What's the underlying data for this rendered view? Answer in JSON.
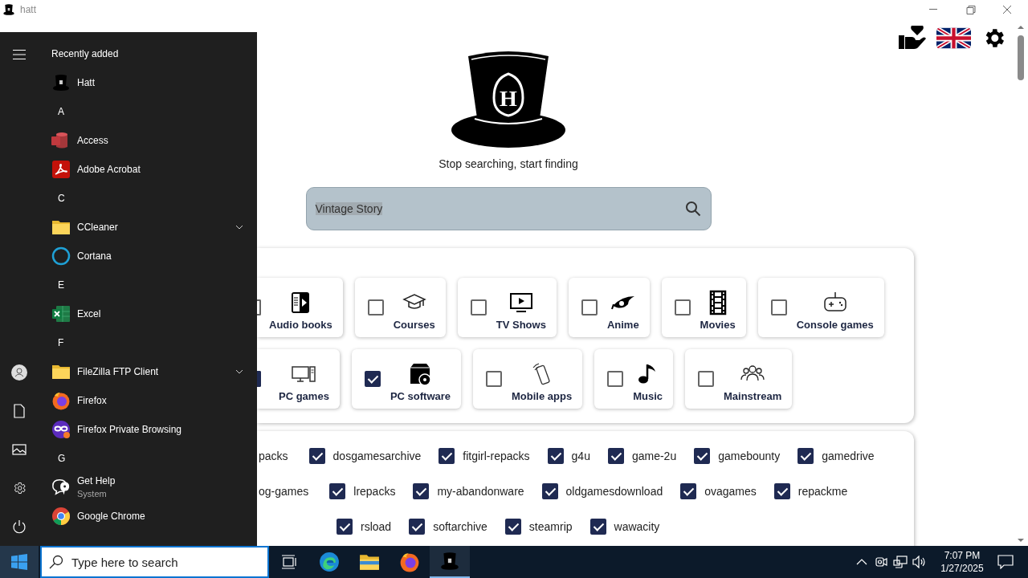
{
  "window": {
    "title": "hatt"
  },
  "logo": {
    "letter": "H"
  },
  "tagline": "Stop searching, start finding",
  "search": {
    "value": "Vintage Story",
    "text_selected": true
  },
  "categories": {
    "rows": [
      [
        {
          "kind": "partial",
          "label": "Audio books",
          "checked": false
        },
        {
          "kind": "full",
          "label": "Courses",
          "checked": false
        },
        {
          "kind": "full",
          "label": "TV Shows",
          "checked": false
        },
        {
          "kind": "full",
          "label": "Anime",
          "checked": false
        },
        {
          "kind": "full",
          "label": "Movies",
          "checked": false
        },
        {
          "kind": "full",
          "label": "Console games",
          "checked": false
        }
      ],
      [
        {
          "kind": "partial",
          "label": "PC games",
          "checked": true
        },
        {
          "kind": "full",
          "label": "PC software",
          "checked": true
        },
        {
          "kind": "full",
          "label": "Mobile apps",
          "checked": false
        },
        {
          "kind": "full",
          "label": "Music",
          "checked": false
        },
        {
          "kind": "full",
          "label": "Mainstream",
          "checked": false
        }
      ]
    ]
  },
  "sources": {
    "rows": [
      {
        "cut_label": "packs",
        "items": [
          {
            "label": "dosgamesarchive",
            "checked": true
          },
          {
            "label": "fitgirl-repacks",
            "checked": true
          },
          {
            "label": "g4u",
            "checked": true
          },
          {
            "label": "game-2u",
            "checked": true
          },
          {
            "label": "gamebounty",
            "checked": true
          },
          {
            "label": "gamedrive",
            "checked": true
          }
        ]
      },
      {
        "cut_label": "og-games",
        "items": [
          {
            "label": "lrepacks",
            "checked": true
          },
          {
            "label": "my-abandonware",
            "checked": true
          },
          {
            "label": "oldgamesdownload",
            "checked": true
          },
          {
            "label": "ovagames",
            "checked": true
          },
          {
            "label": "repackme",
            "checked": true
          }
        ]
      },
      {
        "items": [
          {
            "label": "rsload",
            "checked": true
          },
          {
            "label": "softarchive",
            "checked": true
          },
          {
            "label": "steamrip",
            "checked": true
          },
          {
            "label": "wawacity",
            "checked": true
          }
        ]
      }
    ]
  },
  "start_menu": {
    "header": "Recently added",
    "items": [
      {
        "kind": "app",
        "label": "Hatt"
      },
      {
        "kind": "letter",
        "label": "A"
      },
      {
        "kind": "app",
        "label": "Access"
      },
      {
        "kind": "app",
        "label": "Adobe Acrobat"
      },
      {
        "kind": "letter",
        "label": "C"
      },
      {
        "kind": "folder",
        "label": "CCleaner"
      },
      {
        "kind": "app",
        "label": "Cortana"
      },
      {
        "kind": "letter",
        "label": "E"
      },
      {
        "kind": "app",
        "label": "Excel"
      },
      {
        "kind": "letter",
        "label": "F"
      },
      {
        "kind": "folder",
        "label": "FileZilla FTP Client"
      },
      {
        "kind": "app",
        "label": "Firefox"
      },
      {
        "kind": "app",
        "label": "Firefox Private Browsing"
      },
      {
        "kind": "letter",
        "label": "G"
      },
      {
        "kind": "app",
        "label": "Get Help",
        "subtitle": "System"
      },
      {
        "kind": "app",
        "label": "Google Chrome"
      }
    ]
  },
  "taskbar": {
    "search_placeholder": "Type here to search",
    "apps": [
      {
        "active": false
      },
      {
        "active": false
      },
      {
        "active": false
      },
      {
        "active": true
      }
    ],
    "clock": {
      "time": "7:07 PM",
      "date": "1/27/2025"
    }
  }
}
